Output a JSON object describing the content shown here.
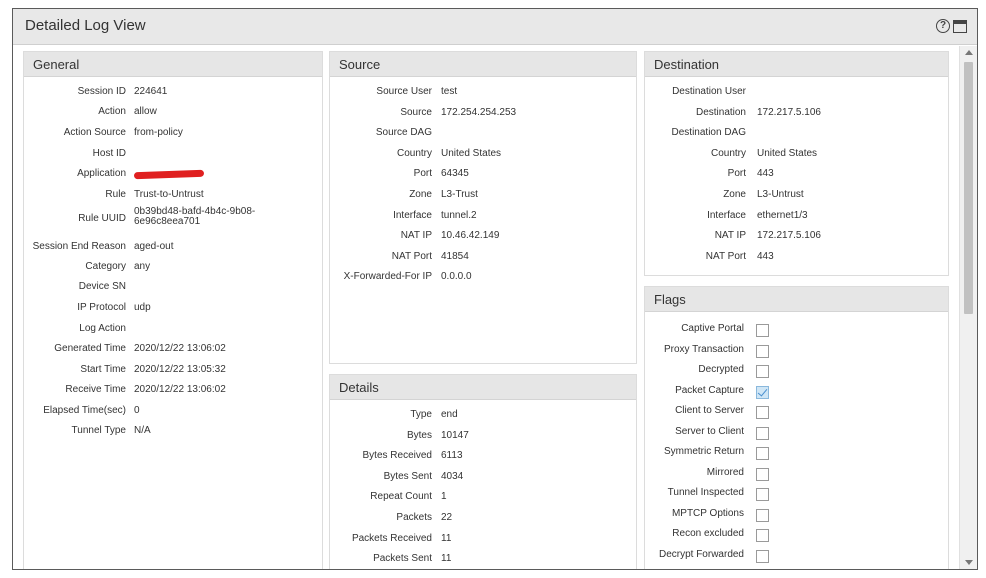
{
  "window": {
    "title": "Detailed Log View"
  },
  "general": {
    "title": "General",
    "rows": [
      {
        "label": "Session ID",
        "value": "224641"
      },
      {
        "label": "Action",
        "value": "allow"
      },
      {
        "label": "Action Source",
        "value": "from-policy"
      },
      {
        "label": "Host ID",
        "value": ""
      },
      {
        "label": "Application",
        "value": ""
      },
      {
        "label": "Rule",
        "value": "Trust-to-Untrust"
      },
      {
        "label": "Rule UUID",
        "value": "0b39bd48-bafd-4b4c-9b08-",
        "value2": "6e96c8eea701"
      },
      {
        "label": "Session End Reason",
        "value": "aged-out"
      },
      {
        "label": "Category",
        "value": "any"
      },
      {
        "label": "Device SN",
        "value": ""
      },
      {
        "label": "IP Protocol",
        "value": "udp"
      },
      {
        "label": "Log Action",
        "value": ""
      },
      {
        "label": "Generated Time",
        "value": "2020/12/22 13:06:02"
      },
      {
        "label": "Start Time",
        "value": "2020/12/22 13:05:32"
      },
      {
        "label": "Receive Time",
        "value": "2020/12/22 13:06:02"
      },
      {
        "label": "Elapsed Time(sec)",
        "value": "0"
      },
      {
        "label": "Tunnel Type",
        "value": "N/A"
      }
    ]
  },
  "source": {
    "title": "Source",
    "rows": [
      {
        "label": "Source User",
        "value": "test"
      },
      {
        "label": "Source",
        "value": "172.254.254.253"
      },
      {
        "label": "Source DAG",
        "value": ""
      },
      {
        "label": "Country",
        "value": "United States"
      },
      {
        "label": "Port",
        "value": "64345"
      },
      {
        "label": "Zone",
        "value": "L3-Trust"
      },
      {
        "label": "Interface",
        "value": "tunnel.2"
      },
      {
        "label": "NAT IP",
        "value": "10.46.42.149"
      },
      {
        "label": "NAT Port",
        "value": "41854"
      },
      {
        "label": "X-Forwarded-For IP",
        "value": "0.0.0.0"
      }
    ]
  },
  "destination": {
    "title": "Destination",
    "rows": [
      {
        "label": "Destination User",
        "value": ""
      },
      {
        "label": "Destination",
        "value": "172.217.5.106"
      },
      {
        "label": "Destination DAG",
        "value": ""
      },
      {
        "label": "Country",
        "value": "United States"
      },
      {
        "label": "Port",
        "value": "443"
      },
      {
        "label": "Zone",
        "value": "L3-Untrust"
      },
      {
        "label": "Interface",
        "value": "ethernet1/3"
      },
      {
        "label": "NAT IP",
        "value": "172.217.5.106"
      },
      {
        "label": "NAT Port",
        "value": "443"
      }
    ]
  },
  "details": {
    "title": "Details",
    "rows": [
      {
        "label": "Type",
        "value": "end"
      },
      {
        "label": "Bytes",
        "value": "10147"
      },
      {
        "label": "Bytes Received",
        "value": "6113"
      },
      {
        "label": "Bytes Sent",
        "value": "4034"
      },
      {
        "label": "Repeat Count",
        "value": "1"
      },
      {
        "label": "Packets",
        "value": "22"
      },
      {
        "label": "Packets Received",
        "value": "11"
      },
      {
        "label": "Packets Sent",
        "value": "11"
      }
    ]
  },
  "flags": {
    "title": "Flags",
    "items": [
      {
        "label": "Captive Portal",
        "checked": false
      },
      {
        "label": "Proxy Transaction",
        "checked": false
      },
      {
        "label": "Decrypted",
        "checked": false
      },
      {
        "label": "Packet Capture",
        "checked": true
      },
      {
        "label": "Client to Server",
        "checked": false
      },
      {
        "label": "Server to Client",
        "checked": false
      },
      {
        "label": "Symmetric Return",
        "checked": false
      },
      {
        "label": "Mirrored",
        "checked": false
      },
      {
        "label": "Tunnel Inspected",
        "checked": false
      },
      {
        "label": "MPTCP Options",
        "checked": false
      },
      {
        "label": "Recon excluded",
        "checked": false
      },
      {
        "label": "Decrypt Forwarded",
        "checked": false
      }
    ]
  },
  "icons": {
    "help": "help-icon",
    "maximize": "maximize-icon"
  }
}
